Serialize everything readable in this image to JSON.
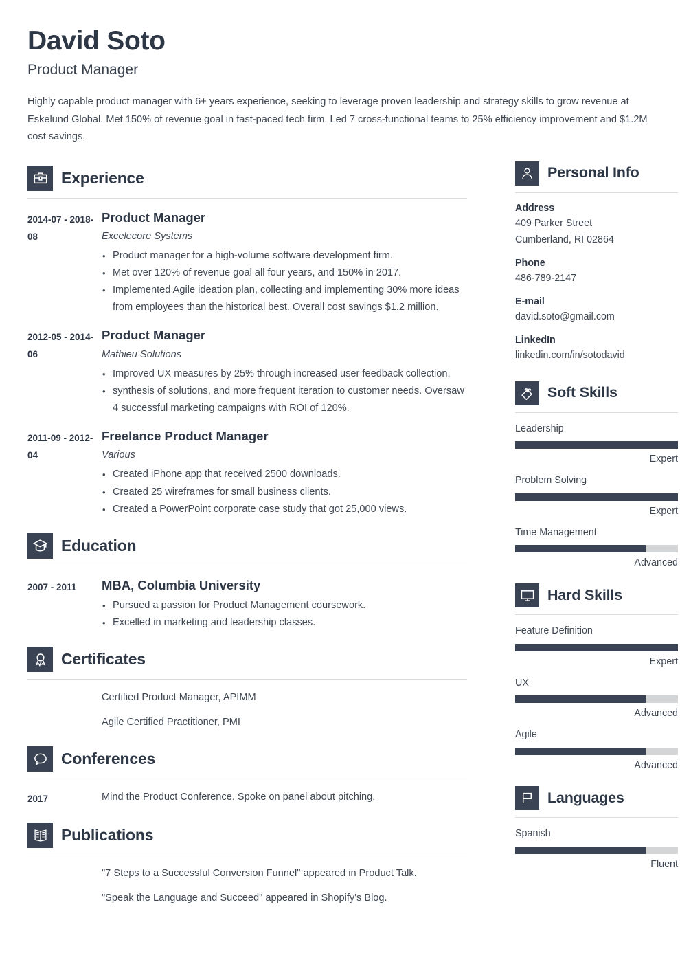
{
  "header": {
    "name": "David Soto",
    "role": "Product Manager",
    "summary": "Highly capable product manager with 6+ years experience, seeking to leverage proven leadership and strategy skills to grow revenue at Eskelund Global. Met 150% of revenue goal in fast-paced tech firm. Led 7 cross-functional teams to 25% efficiency improvement and $1.2M cost savings."
  },
  "main": {
    "experience": {
      "title": "Experience",
      "icon": "briefcase-icon",
      "entries": [
        {
          "dates": "2014-07 - 2018-08",
          "title": "Product Manager",
          "org": "Excelecore Systems",
          "bullets": [
            "Product manager for a high-volume software development firm.",
            "Met over 120% of revenue goal all four years, and 150% in 2017.",
            "Implemented Agile ideation plan, collecting and implementing 30% more ideas from employees than the historical best. Overall cost savings $1.2 million."
          ]
        },
        {
          "dates": "2012-05 - 2014-06",
          "title": "Product Manager",
          "org": "Mathieu Solutions",
          "bullets": [
            "Improved UX measures by 25% through increased user feedback collection,",
            "synthesis of solutions, and more frequent iteration to customer needs. Oversaw 4 successful marketing campaigns with ROI of 120%."
          ]
        },
        {
          "dates": "2011-09 - 2012-04",
          "title": "Freelance Product Manager",
          "org": "Various",
          "bullets": [
            "Created iPhone app that received 2500 downloads.",
            "Created 25 wireframes for small business clients.",
            "Created a PowerPoint corporate case study that got 25,000 views."
          ]
        }
      ]
    },
    "education": {
      "title": "Education",
      "icon": "graduation-cap-icon",
      "entries": [
        {
          "dates": "2007 - 2011",
          "title": "MBA, Columbia University",
          "bullets": [
            "Pursued a passion for Product Management coursework.",
            "Excelled in marketing and leadership classes."
          ]
        }
      ]
    },
    "certificates": {
      "title": "Certificates",
      "icon": "award-ribbon-icon",
      "items": [
        "Certified Product Manager, APIMM",
        "Agile Certified Practitioner, PMI"
      ]
    },
    "conferences": {
      "title": "Conferences",
      "icon": "speech-bubble-icon",
      "entries": [
        {
          "dates": "2017",
          "text": "Mind the Product Conference. Spoke on panel about pitching."
        }
      ]
    },
    "publications": {
      "title": "Publications",
      "icon": "open-book-icon",
      "items": [
        "\"7 Steps to a Successful Conversion Funnel\" appeared in Product Talk.",
        "\"Speak the Language and Succeed\" appeared in Shopify's Blog."
      ]
    }
  },
  "sidebar": {
    "personal_info": {
      "title": "Personal Info",
      "icon": "person-icon",
      "fields": [
        {
          "label": "Address",
          "lines": [
            "409 Parker Street",
            "Cumberland, RI 02864"
          ]
        },
        {
          "label": "Phone",
          "lines": [
            "486-789-2147"
          ]
        },
        {
          "label": "E-mail",
          "lines": [
            "david.soto@gmail.com"
          ]
        },
        {
          "label": "LinkedIn",
          "lines": [
            "linkedin.com/in/sotodavid"
          ]
        }
      ]
    },
    "soft_skills": {
      "title": "Soft Skills",
      "icon": "puzzle-piece-icon",
      "skills": [
        {
          "name": "Leadership",
          "level": "Expert",
          "percent": 100
        },
        {
          "name": "Problem Solving",
          "level": "Expert",
          "percent": 100
        },
        {
          "name": "Time Management",
          "level": "Advanced",
          "percent": 80
        }
      ]
    },
    "hard_skills": {
      "title": "Hard Skills",
      "icon": "monitor-icon",
      "skills": [
        {
          "name": "Feature Definition",
          "level": "Expert",
          "percent": 100
        },
        {
          "name": "UX",
          "level": "Advanced",
          "percent": 80
        },
        {
          "name": "Agile",
          "level": "Advanced",
          "percent": 80
        }
      ]
    },
    "languages": {
      "title": "Languages",
      "icon": "flag-icon",
      "skills": [
        {
          "name": "Spanish",
          "level": "Fluent",
          "percent": 80
        }
      ]
    }
  },
  "colors": {
    "accent_dark": "#3a4353",
    "heading": "#2e3745",
    "body_text": "#404854",
    "bar_track": "#d4d5d7",
    "rule": "#dcdcdc"
  }
}
